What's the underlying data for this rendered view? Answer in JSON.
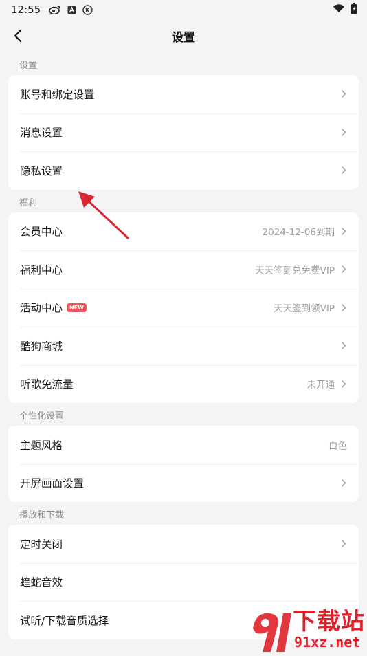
{
  "status_bar": {
    "time": "12:55",
    "icons": [
      "weibo-icon",
      "a-badge-icon",
      "k-badge-icon",
      "wifi-icon",
      "battery-icon"
    ]
  },
  "nav": {
    "title": "设置"
  },
  "sections": [
    {
      "title": "设置",
      "rows": [
        {
          "label": "账号和绑定设置"
        },
        {
          "label": "消息设置"
        },
        {
          "label": "隐私设置"
        }
      ]
    },
    {
      "title": "福利",
      "rows": [
        {
          "label": "会员中心",
          "value": "2024-12-06到期"
        },
        {
          "label": "福利中心",
          "value": "天天签到兑免费VIP"
        },
        {
          "label": "活动中心",
          "badge": "NEW",
          "value": "天天签到领VIP"
        },
        {
          "label": "酷狗商城"
        },
        {
          "label": "听歌免流量",
          "value": "未开通"
        }
      ]
    },
    {
      "title": "个性化设置",
      "rows": [
        {
          "label": "主题风格",
          "value": "白色"
        },
        {
          "label": "开屏画面设置"
        }
      ]
    },
    {
      "title": "播放和下载",
      "rows": [
        {
          "label": "定时关闭"
        },
        {
          "label": "蝰蛇音效"
        },
        {
          "label": "试听/下载音质选择"
        }
      ]
    }
  ],
  "watermark": {
    "text": "下载站",
    "url_text": "91xz.net",
    "mark": "91"
  },
  "colors": {
    "background": "#f4f4f6",
    "card": "#ffffff",
    "badge": "#ff4d4f",
    "arrow": "#d9282f",
    "watermark": "#e0212a"
  }
}
